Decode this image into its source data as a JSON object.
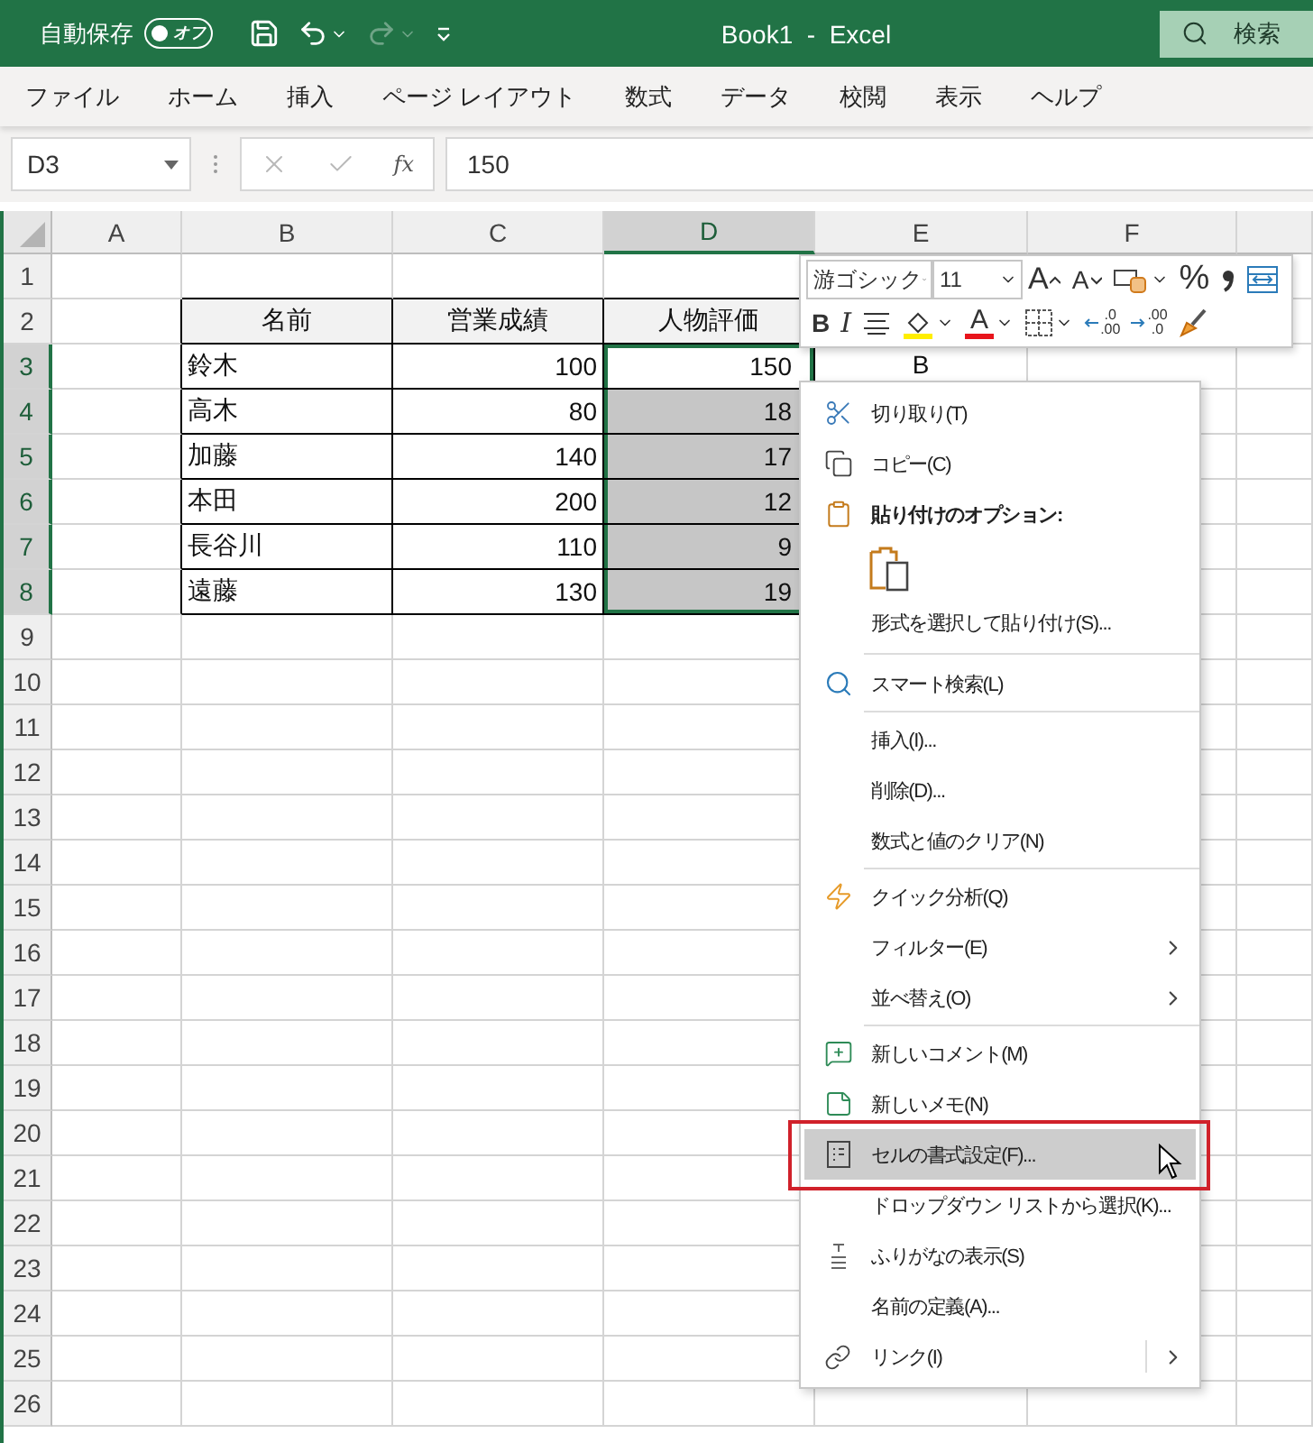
{
  "title_bar": {
    "autosave": {
      "label": "自動保存",
      "on": false,
      "toggle_text": "オフ"
    },
    "quick_access": [
      {
        "kind": "save",
        "disabled": false,
        "dropdown": false
      },
      {
        "kind": "undo",
        "disabled": false,
        "dropdown": true
      },
      {
        "kind": "redo",
        "disabled": true,
        "dropdown": true
      },
      {
        "kind": "customize",
        "disabled": false,
        "dropdown": false
      }
    ],
    "title": "Book1  -  Excel",
    "search": {
      "placeholder": "検索"
    }
  },
  "ribbon_tabs": [
    {
      "label": "ファイル"
    },
    {
      "label": "ホーム"
    },
    {
      "label": "挿入"
    },
    {
      "label": "ページ レイアウト"
    },
    {
      "label": "数式"
    },
    {
      "label": "データ"
    },
    {
      "label": "校閲"
    },
    {
      "label": "表示"
    },
    {
      "label": "ヘルプ"
    }
  ],
  "formula_bar": {
    "name_box": {
      "value": "D3"
    },
    "buttons": [
      {
        "kind": "cancel",
        "disabled": true
      },
      {
        "kind": "enter",
        "disabled": true
      },
      {
        "kind": "function",
        "label": "fx",
        "disabled": false
      }
    ],
    "value": "150"
  },
  "sheet": {
    "columns": [
      {
        "label": "A",
        "selected": false
      },
      {
        "label": "B",
        "selected": false
      },
      {
        "label": "C",
        "selected": false
      },
      {
        "label": "D",
        "selected": true
      },
      {
        "label": "E",
        "selected": false
      },
      {
        "label": "F",
        "selected": false
      }
    ],
    "rows": [
      {
        "label": "1",
        "selected": false
      },
      {
        "label": "2",
        "selected": false
      },
      {
        "label": "3",
        "selected": true
      },
      {
        "label": "4",
        "selected": true
      },
      {
        "label": "5",
        "selected": true
      },
      {
        "label": "6",
        "selected": true
      },
      {
        "label": "7",
        "selected": true
      },
      {
        "label": "8",
        "selected": true
      },
      {
        "label": "9",
        "selected": false
      },
      {
        "label": "10",
        "selected": false
      },
      {
        "label": "11",
        "selected": false
      },
      {
        "label": "12",
        "selected": false
      },
      {
        "label": "13",
        "selected": false
      },
      {
        "label": "14",
        "selected": false
      },
      {
        "label": "15",
        "selected": false
      },
      {
        "label": "16",
        "selected": false
      },
      {
        "label": "17",
        "selected": false
      },
      {
        "label": "18",
        "selected": false
      },
      {
        "label": "19",
        "selected": false
      },
      {
        "label": "20",
        "selected": false
      },
      {
        "label": "21",
        "selected": false
      },
      {
        "label": "22",
        "selected": false
      },
      {
        "label": "23",
        "selected": false
      },
      {
        "label": "24",
        "selected": false
      },
      {
        "label": "25",
        "selected": false
      },
      {
        "label": "26",
        "selected": false
      }
    ],
    "table": {
      "header": [
        "名前",
        "営業成績",
        "人物評価"
      ],
      "rows": [
        {
          "cells": [
            "鈴木",
            "100",
            "150"
          ],
          "selected": true,
          "active": true
        },
        {
          "cells": [
            "高木",
            "80",
            "18"
          ],
          "selected": true,
          "active": false
        },
        {
          "cells": [
            "加藤",
            "140",
            "17"
          ],
          "selected": true,
          "active": false
        },
        {
          "cells": [
            "本田",
            "200",
            "12"
          ],
          "selected": true,
          "active": false
        },
        {
          "cells": [
            "長谷川",
            "110",
            "9"
          ],
          "selected": true,
          "active": false
        },
        {
          "cells": [
            "遠藤",
            "130",
            "19"
          ],
          "selected": true,
          "active": false
        }
      ]
    },
    "cell_E3": {
      "value": "B"
    }
  },
  "mini_toolbar": {
    "font": {
      "value": "游ゴシック"
    },
    "size": {
      "value": "11"
    },
    "row1": [
      {
        "kind": "grow",
        "label": "A",
        "dropdown": false
      },
      {
        "kind": "shrink",
        "label": "A",
        "dropdown": false
      },
      {
        "kind": "accounting",
        "dropdown": true
      },
      {
        "kind": "percent",
        "label": "%",
        "dropdown": false
      },
      {
        "kind": "comma",
        "dropdown": false
      },
      {
        "kind": "wrap",
        "dropdown": false
      }
    ],
    "row2": [
      {
        "kind": "bold",
        "label": "B",
        "dropdown": false
      },
      {
        "kind": "italic",
        "label": "I",
        "dropdown": false
      },
      {
        "kind": "center",
        "dropdown": false
      },
      {
        "kind": "fill",
        "dropdown": true
      },
      {
        "kind": "fontcolor",
        "label": "A",
        "dropdown": true
      },
      {
        "kind": "borders",
        "dropdown": true
      },
      {
        "kind": "incdec",
        "top": ".0",
        "bottom": ".00",
        "dropdown": false
      },
      {
        "kind": "decdec",
        "top": ".00",
        "bottom": ".0",
        "dropdown": false
      },
      {
        "kind": "painter",
        "dropdown": false
      }
    ]
  },
  "context_menu": {
    "items": [
      {
        "kind": "item",
        "label": "切り取り(T)",
        "submenu": false,
        "highlighted": false
      },
      {
        "kind": "item",
        "label": "コピー(C)",
        "submenu": false,
        "highlighted": false
      },
      {
        "kind": "header",
        "label": "貼り付けのオプション:"
      },
      {
        "kind": "paste-options"
      },
      {
        "kind": "item",
        "label": "形式を選択して貼り付け(S)...",
        "submenu": false,
        "highlighted": false
      },
      {
        "kind": "separator"
      },
      {
        "kind": "item",
        "label": "スマート検索(L)",
        "submenu": false,
        "highlighted": false
      },
      {
        "kind": "separator"
      },
      {
        "kind": "item",
        "label": "挿入(I)...",
        "submenu": false,
        "highlighted": false
      },
      {
        "kind": "item",
        "label": "削除(D)...",
        "submenu": false,
        "highlighted": false
      },
      {
        "kind": "item",
        "label": "数式と値のクリア(N)",
        "submenu": false,
        "highlighted": false
      },
      {
        "kind": "separator"
      },
      {
        "kind": "item",
        "label": "クイック分析(Q)",
        "submenu": false,
        "highlighted": false
      },
      {
        "kind": "item",
        "label": "フィルター(E)",
        "submenu": true,
        "highlighted": false
      },
      {
        "kind": "item",
        "label": "並べ替え(O)",
        "submenu": true,
        "highlighted": false
      },
      {
        "kind": "separator"
      },
      {
        "kind": "item",
        "label": "新しいコメント(M)",
        "submenu": false,
        "highlighted": false
      },
      {
        "kind": "item",
        "label": "新しいメモ(N)",
        "submenu": false,
        "highlighted": false
      },
      {
        "kind": "item",
        "label": "セルの書式設定(F)...",
        "submenu": false,
        "highlighted": true
      },
      {
        "kind": "item",
        "label": "ドロップダウン リストから選択(K)...",
        "submenu": false,
        "highlighted": false
      },
      {
        "kind": "item",
        "label": "ふりがなの表示(S)",
        "submenu": false,
        "highlighted": false
      },
      {
        "kind": "item",
        "label": "名前の定義(A)...",
        "submenu": false,
        "highlighted": false
      },
      {
        "kind": "item",
        "label": "リンク(I)",
        "submenu": true,
        "highlighted": false
      }
    ]
  }
}
